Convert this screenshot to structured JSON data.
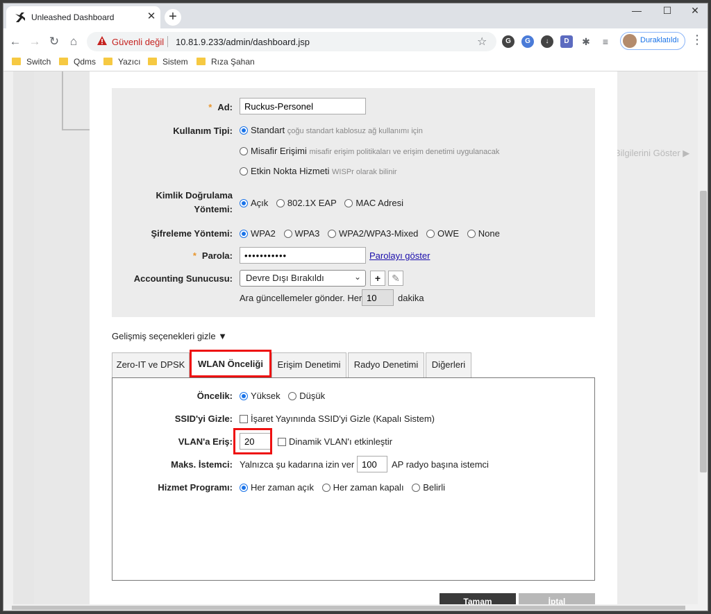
{
  "browser": {
    "tab_title": "Unleashed Dashboard",
    "new_tab": "+",
    "security_label": "Güvenli değil",
    "url": "10.81.9.233/admin/dashboard.jsp",
    "profile_label": "Duraklatıldı",
    "bookmarks": [
      "Switch",
      "Qdms",
      "Yazıcı",
      "Sistem",
      "Rıza Şahan"
    ]
  },
  "page": {
    "show_info_link": "Bilgilerini Göster",
    "form": {
      "name": {
        "label": "Ad:",
        "value": "Ruckus-Personel"
      },
      "usage_type": {
        "label": "Kullanım Tipi:",
        "options": [
          {
            "label": "Standart",
            "hint": "çoğu standart kablosuz ağ kullanımı için",
            "selected": true
          },
          {
            "label": "Misafir Erişimi",
            "hint": "misafir erişim politikaları ve erişim denetimi uygulanacak",
            "selected": false
          },
          {
            "label": "Etkin Nokta Hizmeti",
            "hint": "WISPr olarak bilinir",
            "selected": false
          }
        ]
      },
      "auth_method": {
        "label_line1": "Kimlik Doğrulama",
        "label_line2": "Yöntemi:",
        "options": [
          {
            "label": "Açık",
            "selected": true
          },
          {
            "label": "802.1X EAP",
            "selected": false
          },
          {
            "label": "MAC Adresi",
            "selected": false
          }
        ]
      },
      "encryption": {
        "label": "Şifreleme Yöntemi:",
        "options": [
          {
            "label": "WPA2",
            "selected": true
          },
          {
            "label": "WPA3",
            "selected": false
          },
          {
            "label": "WPA2/WPA3-Mixed",
            "selected": false
          },
          {
            "label": "OWE",
            "selected": false
          },
          {
            "label": "None",
            "selected": false
          }
        ]
      },
      "password": {
        "label": "Parola:",
        "value": "•••••••••••",
        "show_link": "Parolayı göster"
      },
      "accounting": {
        "label": "Accounting Sunucusu:",
        "selected": "Devre Dışı Bırakıldı",
        "add_icon": "+",
        "edit_icon": "✎",
        "interim_prefix": "Ara güncellemeler gönder. Her",
        "interim_value": "10",
        "interim_suffix": "dakika"
      }
    },
    "advanced_toggle": "Gelişmiş seçenekleri gizle ▼",
    "tabs": [
      "Zero-IT ve DPSK",
      "WLAN Önceliği",
      "Erişim Denetimi",
      "Radyo Denetimi",
      "Diğerleri"
    ],
    "active_tab": "WLAN Önceliği",
    "priority_panel": {
      "priority": {
        "label": "Öncelik:",
        "options": [
          {
            "label": "Yüksek",
            "selected": true
          },
          {
            "label": "Düşük",
            "selected": false
          }
        ]
      },
      "hide_ssid": {
        "label": "SSID'yi Gizle:",
        "option": "İşaret Yayınında SSID'yi Gizle (Kapalı Sistem)"
      },
      "vlan": {
        "label": "VLAN'a Eriş:",
        "value": "20",
        "dynamic": "Dinamik VLAN'ı etkinleştir"
      },
      "max_clients": {
        "label": "Maks. İstemci:",
        "prefix": "Yalnızca şu kadarına izin ver",
        "value": "100",
        "suffix": "AP radyo başına istemci"
      },
      "schedule": {
        "label": "Hizmet Programı:",
        "options": [
          {
            "label": "Her zaman açık",
            "selected": true
          },
          {
            "label": "Her zaman kapalı",
            "selected": false
          },
          {
            "label": "Belirli",
            "selected": false
          }
        ]
      }
    },
    "buttons": {
      "ok": "Tamam",
      "cancel": "İptal"
    }
  }
}
